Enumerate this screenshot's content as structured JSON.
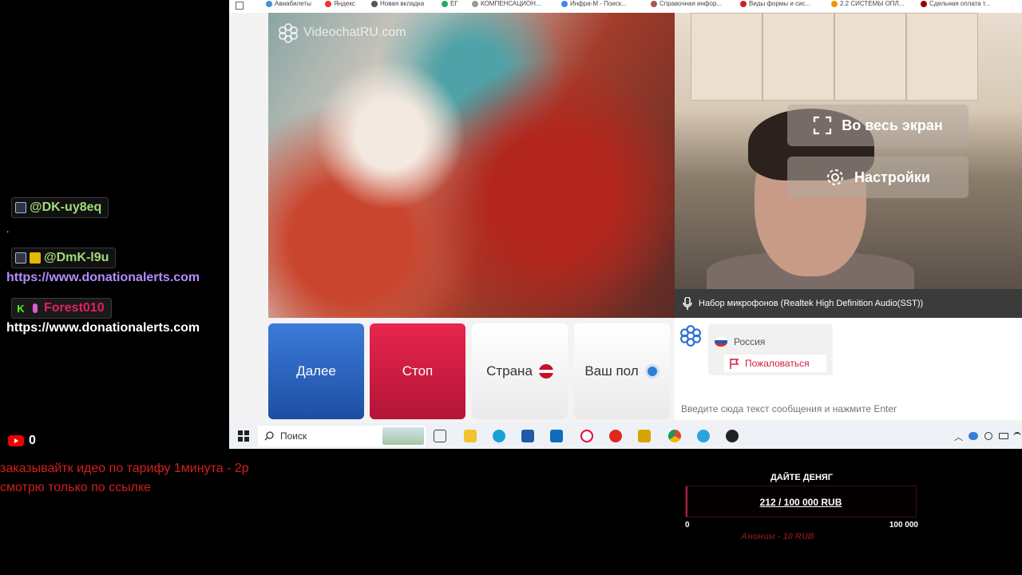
{
  "chat": {
    "messages": [
      {
        "nick": "@DK-uy8eq",
        "color": "#a3d977"
      },
      {
        "nick": "@DmK-l9u",
        "color": "#a3d977",
        "link": "https://www.donationalerts.com"
      },
      {
        "nick": "Forest010",
        "color": "#e0215b",
        "link": "https://www.donationalerts.com"
      }
    ],
    "dot": "."
  },
  "bookmarks": [
    "Авиабилеты",
    "Яндекс",
    "Новая вкладка",
    "ЕГ",
    "КОМПЕНСАЦИОН...",
    "Инфра-М - Поиск...",
    "Справочная инфор...",
    "Виды формы и сис...",
    "2.2 СИСТЕМЫ ОПЛ...",
    "Сдельная оплата т..."
  ],
  "video": {
    "watermark": "VideochatRU.com",
    "fullscreen_label": "Во весь экран",
    "settings_label": "Настройки",
    "mic_label": "Набор микрофонов (Realtek High Definition Audio(SST))"
  },
  "controls": {
    "next": "Далее",
    "stop": "Стоп",
    "country": "Страна",
    "gender": "Ваш пол"
  },
  "partner": {
    "country": "Россия",
    "report": "Пожаловаться"
  },
  "message_input_placeholder": "Введите сюда текст сообщения и нажмите Enter",
  "taskbar": {
    "search_label": "Поиск"
  },
  "stream": {
    "youtube_viewers": "0",
    "promo_line1": "заказывайтк идео по тарифу 1минута - 2р",
    "promo_line2": "смотрю только по ссылке"
  },
  "donation": {
    "title": "ДАЙТЕ ДЕНЯГ",
    "progress_text": "212 / 100 000 RUB",
    "progress_fraction": 0.00212,
    "min": "0",
    "max": "100 000",
    "last": "Аноним - 10 RUB"
  },
  "colors": {
    "accent_blue": "#1e4ea3",
    "accent_red": "#d11c44",
    "promo_red": "#d41e1e",
    "link_purple": "#b58cff"
  }
}
